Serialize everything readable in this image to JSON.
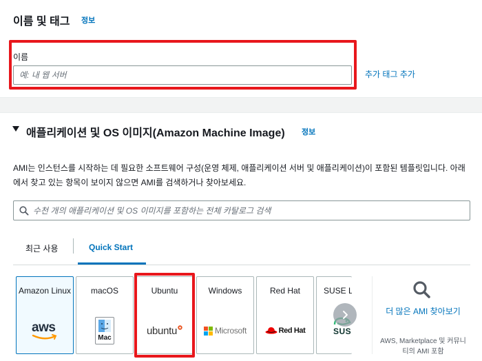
{
  "name_section": {
    "title": "이름 및 태그",
    "info": "정보",
    "name_label": "이름",
    "name_placeholder": "예: 내 웹 서버",
    "add_tag": "추가 태그 추가"
  },
  "ami_section": {
    "title": "애플리케이션 및 OS 이미지(Amazon Machine Image)",
    "info": "정보",
    "description": "AMI는 인스턴스를 시작하는 데 필요한 소프트웨어 구성(운영 체제, 애플리케이션 서버 및 애플리케이션)이 포함된 템플릿입니다. 아래에서 찾고 있는 항목이 보이지 않으면 AMI를 검색하거나 찾아보세요.",
    "search_placeholder": "수천 개의 애플리케이션 및 OS 이미지를 포함하는 전체 카탈로그 검색",
    "tabs": [
      {
        "label": "최근 사용",
        "active": false
      },
      {
        "label": "Quick Start",
        "active": true
      }
    ],
    "cards": [
      {
        "title": "Amazon Linux",
        "logo_text": "aws",
        "selected": true
      },
      {
        "title": "macOS",
        "logo_text": "Mac",
        "selected": false
      },
      {
        "title": "Ubuntu",
        "logo_text": "ubuntu",
        "selected": false
      },
      {
        "title": "Windows",
        "logo_text": "Microsoft",
        "selected": false
      },
      {
        "title": "Red Hat",
        "logo_text": "Red Hat",
        "selected": false
      },
      {
        "title": "SUSE Li",
        "logo_text": "SUS",
        "selected": false
      }
    ],
    "more_ami": {
      "title": "더 많은 AMI 찾아보기",
      "subtitle": "AWS, Marketplace 및 커뮤니티의 AMI 포함"
    }
  },
  "colors": {
    "highlight": "#e8171c",
    "link": "#0073bb",
    "aws_orange": "#ff9900",
    "ubuntu_orange": "#e95420",
    "redhat_red": "#ee0000",
    "suse_green": "#30ba78"
  },
  "icons": [
    "search-icon",
    "carousel-next-icon",
    "magnifier-icon",
    "finder-icon",
    "windows-logo-icon",
    "redhat-hat-icon",
    "aws-smile-icon",
    "suse-chameleon-icon"
  ]
}
